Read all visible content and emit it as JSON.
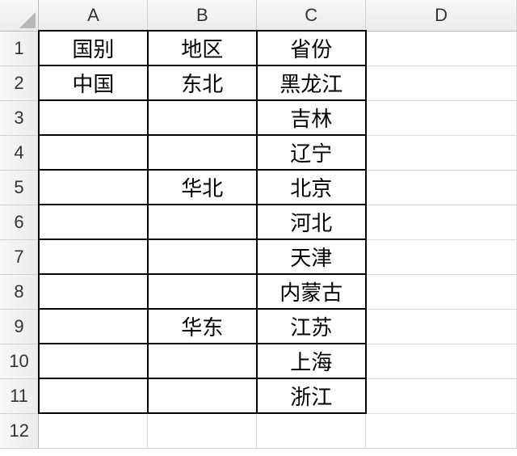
{
  "columns": [
    "A",
    "B",
    "C",
    "D"
  ],
  "row_numbers": [
    "1",
    "2",
    "3",
    "4",
    "5",
    "6",
    "7",
    "8",
    "9",
    "10",
    "11",
    "12"
  ],
  "chart_data": {
    "type": "table",
    "headers": [
      "国别",
      "地区",
      "省份"
    ],
    "rows": [
      [
        "中国",
        "东北",
        "黑龙江"
      ],
      [
        "",
        "",
        "吉林"
      ],
      [
        "",
        "",
        "辽宁"
      ],
      [
        "",
        "华北",
        "北京"
      ],
      [
        "",
        "",
        "河北"
      ],
      [
        "",
        "",
        "天津"
      ],
      [
        "",
        "",
        "内蒙古"
      ],
      [
        "",
        "华东",
        "江苏"
      ],
      [
        "",
        "",
        "上海"
      ],
      [
        "",
        "",
        "浙江"
      ]
    ]
  },
  "cells": {
    "r1": {
      "a": "国别",
      "b": "地区",
      "c": "省份"
    },
    "r2": {
      "a": "中国",
      "b": "东北",
      "c": "黑龙江"
    },
    "r3": {
      "a": "",
      "b": "",
      "c": "吉林"
    },
    "r4": {
      "a": "",
      "b": "",
      "c": "辽宁"
    },
    "r5": {
      "a": "",
      "b": "华北",
      "c": "北京"
    },
    "r6": {
      "a": "",
      "b": "",
      "c": "河北"
    },
    "r7": {
      "a": "",
      "b": "",
      "c": "天津"
    },
    "r8": {
      "a": "",
      "b": "",
      "c": "内蒙古"
    },
    "r9": {
      "a": "",
      "b": "华东",
      "c": "江苏"
    },
    "r10": {
      "a": "",
      "b": "",
      "c": "上海"
    },
    "r11": {
      "a": "",
      "b": "",
      "c": "浙江"
    },
    "r12": {
      "a": "",
      "b": "",
      "c": ""
    }
  }
}
